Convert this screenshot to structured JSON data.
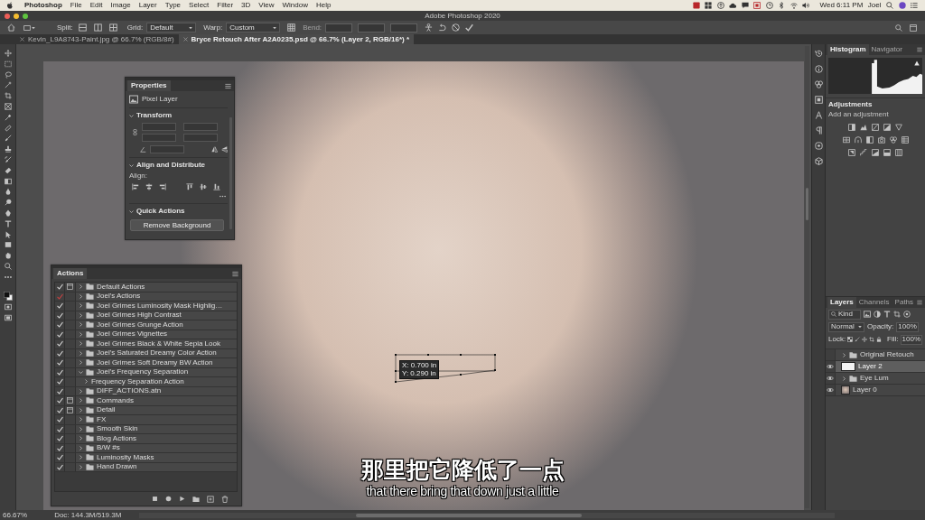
{
  "menu_bar": {
    "app_name": "Photoshop",
    "menus": [
      "File",
      "Edit",
      "Image",
      "Layer",
      "Type",
      "Select",
      "Filter",
      "3D",
      "View",
      "Window",
      "Help"
    ],
    "clock": "Wed 6:11 PM",
    "user": "Joel"
  },
  "window": {
    "title": "Adobe Photoshop 2020"
  },
  "options_bar": {
    "split_label": "Split:",
    "grid_label": "Grid:",
    "grid_value": "Default",
    "warp_label": "Warp:",
    "warp_value": "Custom",
    "bend_label": "Bend:",
    "bend_disabled": true
  },
  "document_tabs": [
    {
      "label": "Kevin_L9A8743-Paint.jpg @ 66.7% (RGB/8#)",
      "selected": false
    },
    {
      "label": "Bryce Retouch After A2A0235.psd @ 66.7% (Layer 2, RGB/16*) *",
      "selected": true
    }
  ],
  "canvas": {
    "transform_readout": [
      "X: 0.700 in",
      "Y: 0.290 in"
    ]
  },
  "properties_panel": {
    "title": "Properties",
    "layer_kind": "Pixel Layer",
    "sections": [
      {
        "title": "Transform",
        "expanded": true
      },
      {
        "title": "Align and Distribute",
        "expanded": true
      },
      {
        "title": "Quick Actions",
        "expanded": true
      }
    ],
    "align_label": "Align:",
    "quick_action_button": "Remove Background"
  },
  "actions_panel": {
    "title": "Actions",
    "items": [
      {
        "name": "Default Actions",
        "kind": "set",
        "enabled": true,
        "partial": false,
        "dialog": true,
        "expanded": false
      },
      {
        "name": "Joel's Actions",
        "kind": "set",
        "enabled": true,
        "partial": true,
        "dialog": false,
        "expanded": false
      },
      {
        "name": "Joel Grimes Luminosity Mask Highlig…",
        "kind": "set",
        "enabled": true,
        "partial": false,
        "dialog": false,
        "expanded": false
      },
      {
        "name": "Joel Grimes High Contrast",
        "kind": "set",
        "enabled": true,
        "partial": false,
        "dialog": false,
        "expanded": false
      },
      {
        "name": "Joel Grimes Grunge Action",
        "kind": "set",
        "enabled": true,
        "partial": false,
        "dialog": false,
        "expanded": false
      },
      {
        "name": "Joel Grimes Vignettes",
        "kind": "set",
        "enabled": true,
        "partial": false,
        "dialog": false,
        "expanded": false
      },
      {
        "name": "Joel Grimes Black & White Sepia Look",
        "kind": "set",
        "enabled": true,
        "partial": false,
        "dialog": false,
        "expanded": false
      },
      {
        "name": "Joel's Saturated Dreamy Color Action",
        "kind": "set",
        "enabled": true,
        "partial": false,
        "dialog": false,
        "expanded": false
      },
      {
        "name": "Joel Grimes Soft Dreamy BW Action",
        "kind": "set",
        "enabled": true,
        "partial": false,
        "dialog": false,
        "expanded": false
      },
      {
        "name": "Joel's Frequency Separation",
        "kind": "set",
        "enabled": true,
        "partial": false,
        "dialog": false,
        "expanded": true,
        "children": [
          {
            "name": "Frequency Separation Action",
            "kind": "action",
            "enabled": true,
            "partial": false,
            "dialog": false,
            "expanded": false
          }
        ]
      },
      {
        "name": "DIFF_ACTIONS.atn",
        "kind": "set",
        "enabled": true,
        "partial": false,
        "dialog": false,
        "expanded": false
      },
      {
        "name": "Commands",
        "kind": "set",
        "enabled": true,
        "partial": false,
        "dialog": true,
        "expanded": false
      },
      {
        "name": "Detail",
        "kind": "set",
        "enabled": true,
        "partial": false,
        "dialog": true,
        "expanded": false
      },
      {
        "name": "FX",
        "kind": "set",
        "enabled": true,
        "partial": false,
        "dialog": false,
        "expanded": false
      },
      {
        "name": "Smooth Skin",
        "kind": "set",
        "enabled": true,
        "partial": false,
        "dialog": false,
        "expanded": false
      },
      {
        "name": "Blog Actions",
        "kind": "set",
        "enabled": true,
        "partial": false,
        "dialog": false,
        "expanded": false
      },
      {
        "name": "B/W #s",
        "kind": "set",
        "enabled": true,
        "partial": false,
        "dialog": false,
        "expanded": false
      },
      {
        "name": "Luminosity Masks",
        "kind": "set",
        "enabled": true,
        "partial": false,
        "dialog": false,
        "expanded": false
      },
      {
        "name": "Hand Drawn",
        "kind": "set",
        "enabled": true,
        "partial": false,
        "dialog": false,
        "expanded": false
      }
    ]
  },
  "histogram_panel": {
    "tabs": [
      {
        "label": "Histogram",
        "selected": true
      },
      {
        "label": "Navigator",
        "selected": false
      }
    ]
  },
  "adjustments_panel": {
    "title": "Adjustments",
    "hint": "Add an adjustment"
  },
  "layers_panel": {
    "tabs": [
      {
        "label": "Layers",
        "selected": true
      },
      {
        "label": "Channels",
        "selected": false
      },
      {
        "label": "Paths",
        "selected": false
      }
    ],
    "filter_kind": "Kind",
    "blend_mode": "Normal",
    "opacity_label": "Opacity:",
    "opacity_value": "100%",
    "lock_label": "Lock:",
    "fill_label": "Fill:",
    "fill_value": "100%",
    "layers": [
      {
        "name": "Original Retouch",
        "kind": "group",
        "visible": false,
        "selected": false,
        "expanded": false
      },
      {
        "name": "Layer 2",
        "kind": "layer",
        "visible": true,
        "selected": true
      },
      {
        "name": "Eye Lum",
        "kind": "group",
        "visible": true,
        "selected": false,
        "expanded": false
      },
      {
        "name": "Layer 0",
        "kind": "image",
        "visible": true,
        "selected": false
      }
    ]
  },
  "status_bar": {
    "zoom": "66.67%",
    "document_size": "Doc: 144.3M/519.3M"
  },
  "subtitles": [
    "那里把它降低了一点",
    "that there bring that down just a little"
  ]
}
